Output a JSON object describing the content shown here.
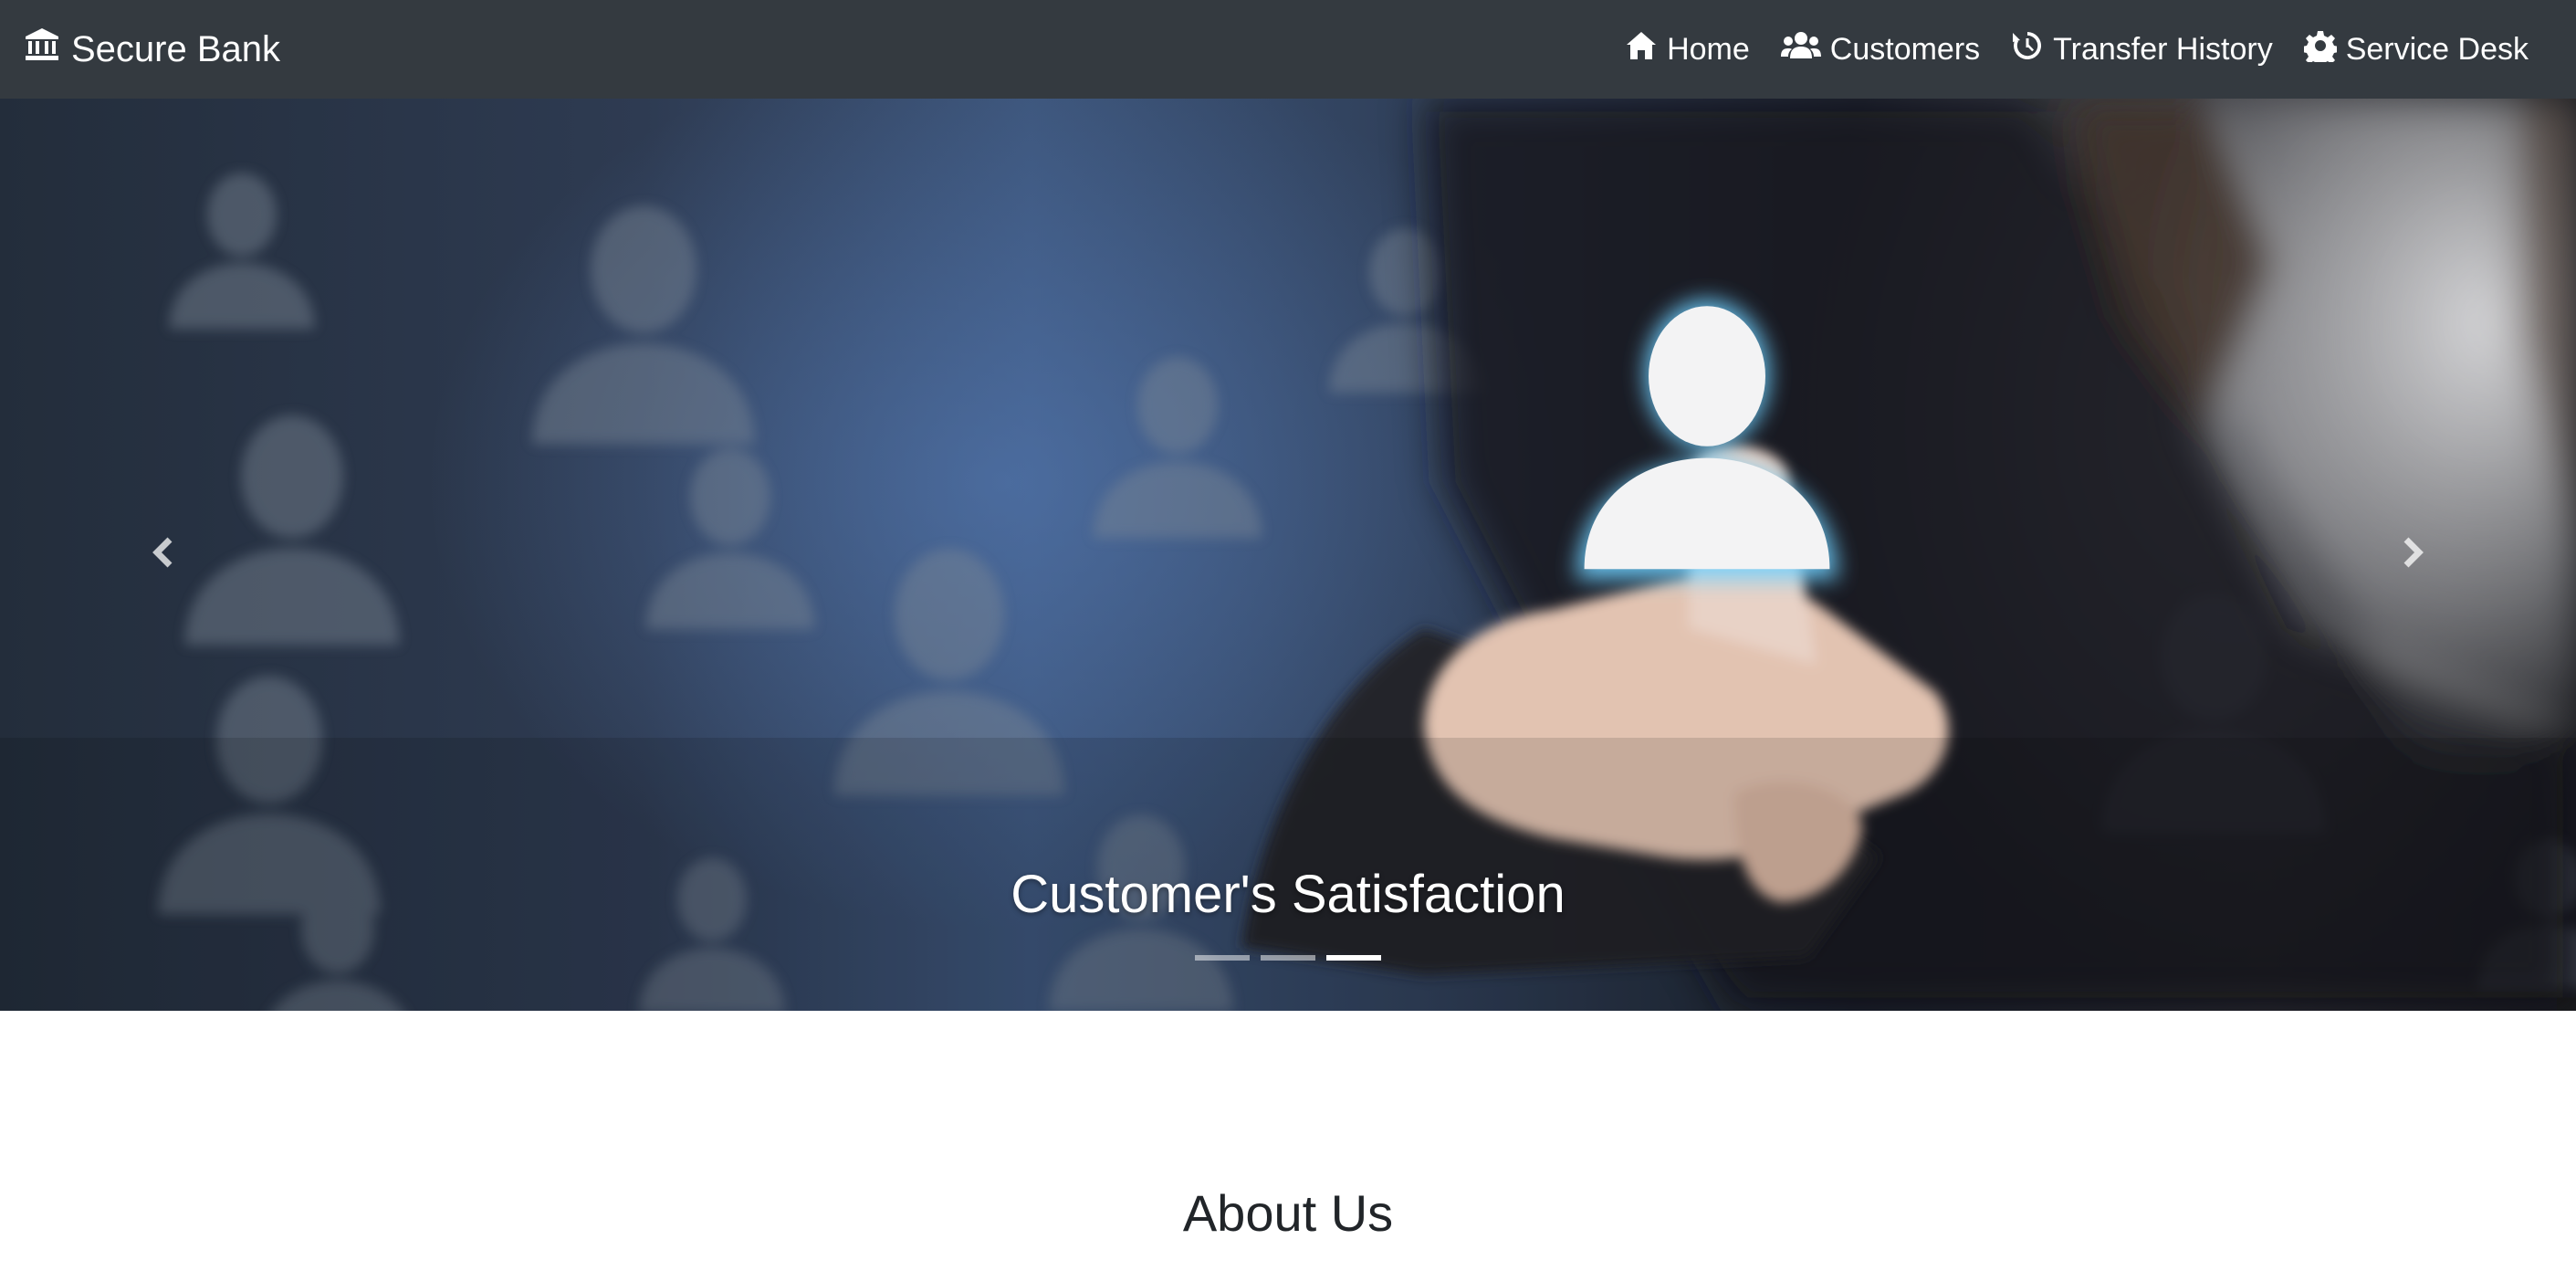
{
  "navbar": {
    "brand": {
      "icon": "bank-icon",
      "label": "Secure Bank"
    },
    "links": [
      {
        "icon": "home-icon",
        "label": "Home"
      },
      {
        "icon": "users-icon",
        "label": "Customers"
      },
      {
        "icon": "history-icon",
        "label": "Transfer History"
      },
      {
        "icon": "gear-icon",
        "label": "Service Desk"
      }
    ]
  },
  "carousel": {
    "caption": "Customer's Satisfaction",
    "prev_icon": "chevron-left-icon",
    "next_icon": "chevron-right-icon",
    "slide_count": 3,
    "active_slide": 3
  },
  "about": {
    "title": "About Us"
  },
  "colors": {
    "navbar_bg": "#343a40",
    "nav_text": "#ffffff",
    "heading_text": "#212529",
    "glow": "#6fd0ff"
  }
}
